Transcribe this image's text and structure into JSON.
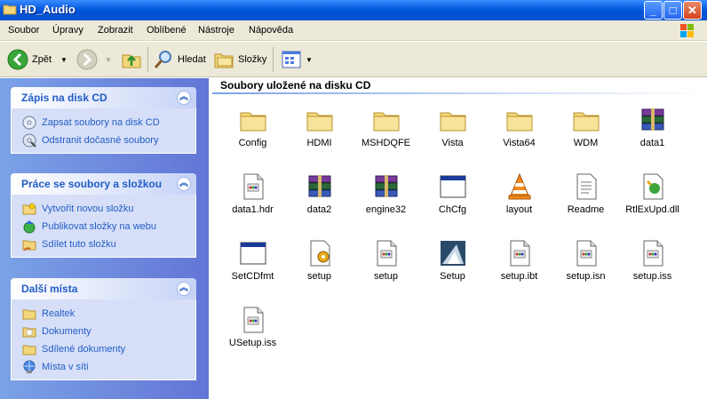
{
  "window": {
    "title": "HD_Audio"
  },
  "menu": [
    "Soubor",
    "Úpravy",
    "Zobrazit",
    "Oblíbené",
    "Nástroje",
    "Nápověda"
  ],
  "toolbar": {
    "back_label": "Zpět",
    "search_label": "Hledat",
    "folders_label": "Složky"
  },
  "panels": [
    {
      "title": "Zápis na disk CD",
      "items": [
        "Zapsat soubory na disk CD",
        "Odstranit dočasné soubory"
      ]
    },
    {
      "title": "Práce se soubory a složkou",
      "items": [
        "Vytvořit novou složku",
        "Publikovat složky na webu",
        "Sdílet tuto složku"
      ]
    },
    {
      "title": "Další místa",
      "items": [
        "Realtek",
        "Dokumenty",
        "Sdílené dokumenty",
        "Místa v síti"
      ]
    }
  ],
  "content": {
    "title": "Soubory uložené na disku CD",
    "files": [
      {
        "name": "Config",
        "icon": "folder"
      },
      {
        "name": "HDMI",
        "icon": "folder"
      },
      {
        "name": "MSHDQFE",
        "icon": "folder"
      },
      {
        "name": "Vista",
        "icon": "folder"
      },
      {
        "name": "Vista64",
        "icon": "folder"
      },
      {
        "name": "WDM",
        "icon": "folder"
      },
      {
        "name": "data1",
        "icon": "archive"
      },
      {
        "name": "data1.hdr",
        "icon": "document"
      },
      {
        "name": "data2",
        "icon": "archive"
      },
      {
        "name": "engine32",
        "icon": "archive"
      },
      {
        "name": "ChCfg",
        "icon": "window"
      },
      {
        "name": "layout",
        "icon": "cone"
      },
      {
        "name": "Readme",
        "icon": "text"
      },
      {
        "name": "RtlExUpd.dll",
        "icon": "dll"
      },
      {
        "name": "SetCDfmt",
        "icon": "window"
      },
      {
        "name": "setup",
        "icon": "setup-gear"
      },
      {
        "name": "setup",
        "icon": "document"
      },
      {
        "name": "Setup",
        "icon": "installer"
      },
      {
        "name": "setup.ibt",
        "icon": "document"
      },
      {
        "name": "setup.isn",
        "icon": "document"
      },
      {
        "name": "setup.iss",
        "icon": "document"
      },
      {
        "name": "USetup.iss",
        "icon": "document"
      }
    ]
  }
}
